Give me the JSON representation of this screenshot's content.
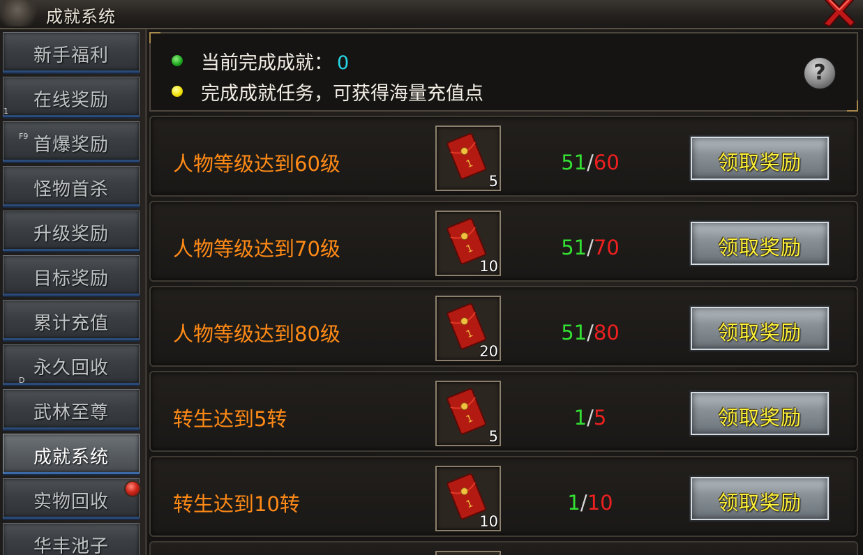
{
  "window": {
    "title": "成就系统",
    "close_icon": "close-x-icon"
  },
  "sidebar": {
    "items": [
      {
        "label": "新手福利",
        "hint": ""
      },
      {
        "label": "在线奖励",
        "hint": "1"
      },
      {
        "label": "首爆奖励",
        "hint": "F9"
      },
      {
        "label": "怪物首杀",
        "hint": ""
      },
      {
        "label": "升级奖励",
        "hint": ""
      },
      {
        "label": "目标奖励",
        "hint": ""
      },
      {
        "label": "累计充值",
        "hint": ""
      },
      {
        "label": "永久回收",
        "hint": "D"
      },
      {
        "label": "武林至尊",
        "hint": ""
      },
      {
        "label": "成就系统",
        "hint": "",
        "active": true
      },
      {
        "label": "实物回收",
        "hint": "",
        "badge": "red-dot"
      },
      {
        "label": "华丰池子",
        "hint": ""
      }
    ]
  },
  "info": {
    "completed_label": "当前完成成就：",
    "completed_count": "0",
    "tip": "完成成就任务，可获得海量充值点",
    "help_glyph": "?"
  },
  "tasks": [
    {
      "title": "人物等级达到60级",
      "reward_qty": "5",
      "current": "51",
      "sep": "/",
      "target": "60",
      "button": "领取奖励"
    },
    {
      "title": "人物等级达到70级",
      "reward_qty": "10",
      "current": "51",
      "sep": "/",
      "target": "70",
      "button": "领取奖励"
    },
    {
      "title": "人物等级达到80级",
      "reward_qty": "20",
      "current": "51",
      "sep": "/",
      "target": "80",
      "button": "领取奖励"
    },
    {
      "title": "转生达到5转",
      "reward_qty": "5",
      "current": "1",
      "sep": "/",
      "target": "5",
      "button": "领取奖励"
    },
    {
      "title": "转生达到10转",
      "reward_qty": "10",
      "current": "1",
      "sep": "/",
      "target": "10",
      "button": "领取奖励"
    }
  ],
  "colors": {
    "task_title": "#ff8a16",
    "progress_current": "#33e033",
    "progress_target": "#ee2020",
    "button_text": "#fff23a",
    "count_value": "#26d6e6"
  },
  "reward_icon": "red-envelope-icon"
}
